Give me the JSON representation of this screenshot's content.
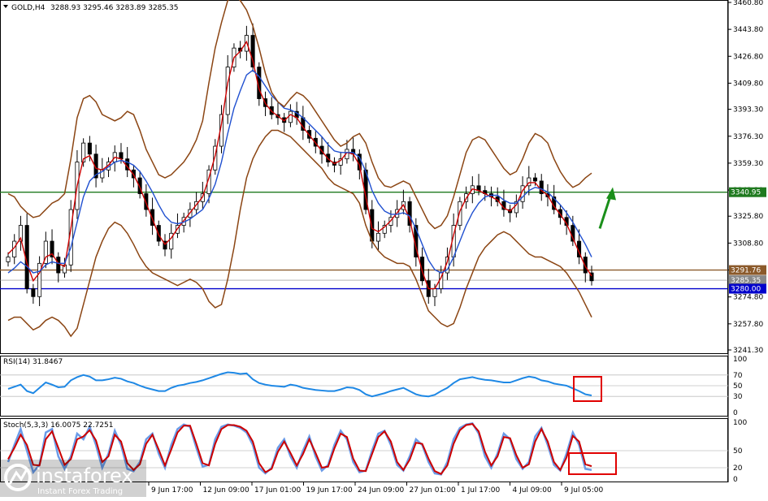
{
  "chart_data": {
    "type": "candlestick",
    "title": "GOLD,H4",
    "ohlc_readout": "3288.93 3295.46 3283.89 3285.35",
    "price_axis": {
      "range": [
        3241.3,
        3460.8
      ],
      "ticks": [
        "3460.80",
        "3443.80",
        "3426.80",
        "3409.80",
        "3393.30",
        "3376.30",
        "3359.30",
        "3342.30",
        "3325.80",
        "3308.80",
        "3291.80",
        "3274.80",
        "3257.80",
        "3241.30"
      ]
    },
    "time_labels": [
      "9 Jun 17:00",
      "12 Jun 09:00",
      "17 Jun 01:00",
      "19 Jun 17:00",
      "24 Jun 09:00",
      "27 Jun 01:00",
      "1 Jul 17:00",
      "4 Jul 09:00",
      "9 Jul 05:00"
    ],
    "levels": [
      {
        "value": 3340.95,
        "label": "3340.95",
        "color": "#1f7a1f"
      },
      {
        "value": 3291.76,
        "label": "3291.76",
        "color": "#8b5a2b"
      },
      {
        "value": 3285.35,
        "label": "3285.35",
        "color": "#888888"
      },
      {
        "value": 3280.0,
        "label": "3280.00",
        "color": "#0000cc"
      }
    ],
    "series": [
      {
        "name": "close",
        "color": "#000000",
        "values": [
          3300,
          3310,
          3320,
          3280,
          3275,
          3296,
          3310,
          3300,
          3290,
          3295,
          3330,
          3360,
          3372,
          3365,
          3350,
          3355,
          3360,
          3366,
          3362,
          3355,
          3350,
          3340,
          3330,
          3320,
          3310,
          3305,
          3315,
          3320,
          3325,
          3330,
          3335,
          3340,
          3355,
          3370,
          3390,
          3420,
          3432,
          3430,
          3440,
          3420,
          3400,
          3395,
          3390,
          3388,
          3385,
          3392,
          3388,
          3380,
          3375,
          3370,
          3365,
          3360,
          3358,
          3362,
          3368,
          3365,
          3355,
          3330,
          3310,
          3315,
          3320,
          3325,
          3330,
          3335,
          3320,
          3300,
          3285,
          3275,
          3280,
          3290,
          3300,
          3320,
          3335,
          3340,
          3345,
          3342,
          3340,
          3338,
          3335,
          3330,
          3328,
          3335,
          3345,
          3350,
          3348,
          3340,
          3338,
          3330,
          3325,
          3320,
          3310,
          3300,
          3290,
          3285
        ]
      },
      {
        "name": "ma-fast",
        "color": "#cc0000",
        "values": [
          3302,
          3306,
          3312,
          3296,
          3285,
          3290,
          3300,
          3302,
          3296,
          3294,
          3318,
          3345,
          3362,
          3364,
          3356,
          3355,
          3358,
          3363,
          3362,
          3357,
          3352,
          3344,
          3334,
          3324,
          3314,
          3308,
          3312,
          3318,
          3323,
          3328,
          3333,
          3338,
          3350,
          3364,
          3384,
          3410,
          3426,
          3430,
          3436,
          3424,
          3406,
          3397,
          3392,
          3389,
          3386,
          3390,
          3388,
          3382,
          3377,
          3372,
          3367,
          3362,
          3359,
          3361,
          3366,
          3365,
          3358,
          3338,
          3318,
          3316,
          3319,
          3323,
          3328,
          3333,
          3324,
          3306,
          3291,
          3280,
          3280,
          3287,
          3297,
          3314,
          3329,
          3337,
          3343,
          3342,
          3340,
          3338,
          3336,
          3331,
          3329,
          3333,
          3342,
          3347,
          3347,
          3342,
          3339,
          3332,
          3327,
          3321,
          3312,
          3303,
          3294,
          3288
        ]
      },
      {
        "name": "ma-slow",
        "color": "#2050d0",
        "values": [
          3290,
          3293,
          3297,
          3294,
          3290,
          3291,
          3295,
          3297,
          3296,
          3296,
          3306,
          3322,
          3338,
          3348,
          3352,
          3354,
          3357,
          3360,
          3361,
          3360,
          3358,
          3354,
          3348,
          3341,
          3333,
          3326,
          3322,
          3321,
          3322,
          3324,
          3327,
          3330,
          3337,
          3346,
          3360,
          3378,
          3394,
          3405,
          3415,
          3418,
          3414,
          3408,
          3402,
          3398,
          3394,
          3393,
          3391,
          3388,
          3384,
          3380,
          3376,
          3371,
          3367,
          3366,
          3366,
          3366,
          3363,
          3354,
          3342,
          3334,
          3329,
          3327,
          3327,
          3328,
          3326,
          3318,
          3308,
          3298,
          3292,
          3290,
          3292,
          3300,
          3310,
          3320,
          3328,
          3334,
          3338,
          3339,
          3339,
          3336,
          3334,
          3334,
          3338,
          3342,
          3344,
          3343,
          3341,
          3337,
          3333,
          3328,
          3322,
          3315,
          3308,
          3300
        ]
      },
      {
        "name": "bb-upper",
        "color": "#8b4513",
        "values": [
          3340,
          3338,
          3332,
          3328,
          3325,
          3326,
          3330,
          3334,
          3336,
          3340,
          3362,
          3388,
          3400,
          3402,
          3398,
          3390,
          3388,
          3386,
          3388,
          3392,
          3390,
          3380,
          3368,
          3360,
          3352,
          3350,
          3352,
          3356,
          3360,
          3366,
          3374,
          3386,
          3410,
          3432,
          3448,
          3462,
          3466,
          3462,
          3456,
          3446,
          3432,
          3416,
          3404,
          3398,
          3395,
          3400,
          3404,
          3402,
          3398,
          3392,
          3386,
          3380,
          3374,
          3370,
          3372,
          3376,
          3378,
          3372,
          3360,
          3350,
          3345,
          3344,
          3346,
          3348,
          3346,
          3338,
          3330,
          3322,
          3318,
          3320,
          3326,
          3338,
          3352,
          3366,
          3374,
          3376,
          3374,
          3368,
          3362,
          3356,
          3352,
          3354,
          3362,
          3372,
          3378,
          3376,
          3372,
          3362,
          3354,
          3348,
          3344,
          3346,
          3350,
          3353
        ]
      },
      {
        "name": "bb-lower",
        "color": "#8b4513",
        "values": [
          3260,
          3262,
          3262,
          3258,
          3254,
          3256,
          3260,
          3262,
          3260,
          3256,
          3250,
          3255,
          3270,
          3285,
          3300,
          3310,
          3318,
          3322,
          3320,
          3315,
          3308,
          3300,
          3294,
          3290,
          3288,
          3286,
          3284,
          3282,
          3284,
          3286,
          3284,
          3280,
          3272,
          3268,
          3270,
          3286,
          3306,
          3330,
          3350,
          3362,
          3370,
          3376,
          3380,
          3380,
          3378,
          3376,
          3372,
          3368,
          3364,
          3360,
          3356,
          3350,
          3346,
          3344,
          3342,
          3340,
          3334,
          3320,
          3310,
          3304,
          3300,
          3298,
          3296,
          3296,
          3294,
          3286,
          3276,
          3266,
          3262,
          3258,
          3256,
          3258,
          3268,
          3280,
          3290,
          3300,
          3306,
          3310,
          3314,
          3316,
          3314,
          3310,
          3306,
          3302,
          3300,
          3300,
          3298,
          3296,
          3294,
          3290,
          3284,
          3278,
          3270,
          3262
        ]
      }
    ],
    "rsi": {
      "title": "RSI(14) 31.8467",
      "levels": [
        "100",
        "70",
        "50",
        "30",
        "0"
      ],
      "color": "#1e88e5",
      "values": [
        44,
        48,
        52,
        40,
        36,
        46,
        56,
        52,
        47,
        48,
        60,
        66,
        70,
        67,
        60,
        60,
        62,
        65,
        63,
        58,
        55,
        50,
        46,
        43,
        40,
        40,
        46,
        50,
        52,
        55,
        57,
        60,
        64,
        68,
        72,
        75,
        74,
        72,
        73,
        62,
        55,
        52,
        50,
        49,
        48,
        52,
        50,
        46,
        44,
        42,
        41,
        40,
        40,
        43,
        47,
        46,
        42,
        34,
        30,
        33,
        36,
        40,
        43,
        46,
        40,
        34,
        31,
        30,
        33,
        40,
        46,
        55,
        62,
        64,
        66,
        63,
        61,
        60,
        58,
        56,
        56,
        60,
        64,
        67,
        65,
        60,
        58,
        54,
        52,
        50,
        45,
        40,
        34,
        31.8
      ]
    },
    "stoch": {
      "title": "Stoch(5,3,3) 16.0075 22.7251",
      "levels": [
        "100",
        "50",
        "20",
        "0"
      ],
      "k": {
        "color": "#6a9be8",
        "values": [
          30,
          60,
          88,
          50,
          12,
          25,
          82,
          88,
          40,
          18,
          40,
          80,
          70,
          92,
          60,
          20,
          45,
          85,
          60,
          18,
          14,
          30,
          70,
          80,
          45,
          20,
          60,
          88,
          96,
          92,
          55,
          22,
          25,
          70,
          92,
          96,
          94,
          90,
          82,
          60,
          20,
          10,
          20,
          55,
          70,
          40,
          20,
          50,
          75,
          40,
          15,
          25,
          60,
          85,
          70,
          30,
          12,
          15,
          50,
          80,
          85,
          60,
          25,
          15,
          40,
          70,
          60,
          30,
          10,
          8,
          30,
          70,
          90,
          96,
          98,
          80,
          40,
          20,
          45,
          80,
          70,
          35,
          18,
          30,
          75,
          90,
          60,
          25,
          15,
          45,
          82,
          60,
          18,
          16
        ]
      },
      "d": {
        "color": "#cc0000",
        "values": [
          35,
          55,
          78,
          60,
          25,
          24,
          70,
          84,
          55,
          25,
          35,
          70,
          75,
          86,
          68,
          30,
          40,
          78,
          66,
          28,
          16,
          26,
          62,
          78,
          52,
          24,
          52,
          82,
          94,
          94,
          62,
          28,
          24,
          62,
          88,
          95,
          95,
          92,
          85,
          66,
          28,
          12,
          18,
          48,
          66,
          46,
          24,
          44,
          70,
          46,
          20,
          22,
          54,
          80,
          74,
          36,
          15,
          14,
          44,
          74,
          84,
          66,
          30,
          16,
          34,
          64,
          62,
          36,
          14,
          9,
          24,
          62,
          86,
          95,
          97,
          84,
          48,
          24,
          40,
          74,
          72,
          42,
          20,
          26,
          66,
          88,
          66,
          30,
          16,
          38,
          76,
          66,
          26,
          22.7
        ]
      }
    },
    "annotations": [
      {
        "kind": "arrow",
        "color": "#1a8f1a"
      },
      {
        "kind": "highlight-box",
        "color": "#e00000",
        "panel": "rsi"
      },
      {
        "kind": "highlight-box",
        "color": "#e00000",
        "panel": "stoch"
      }
    ],
    "grid": false
  },
  "watermark": {
    "brand": "instaforex",
    "tagline": "Instant Forex Trading",
    "color": "#ffffff"
  }
}
